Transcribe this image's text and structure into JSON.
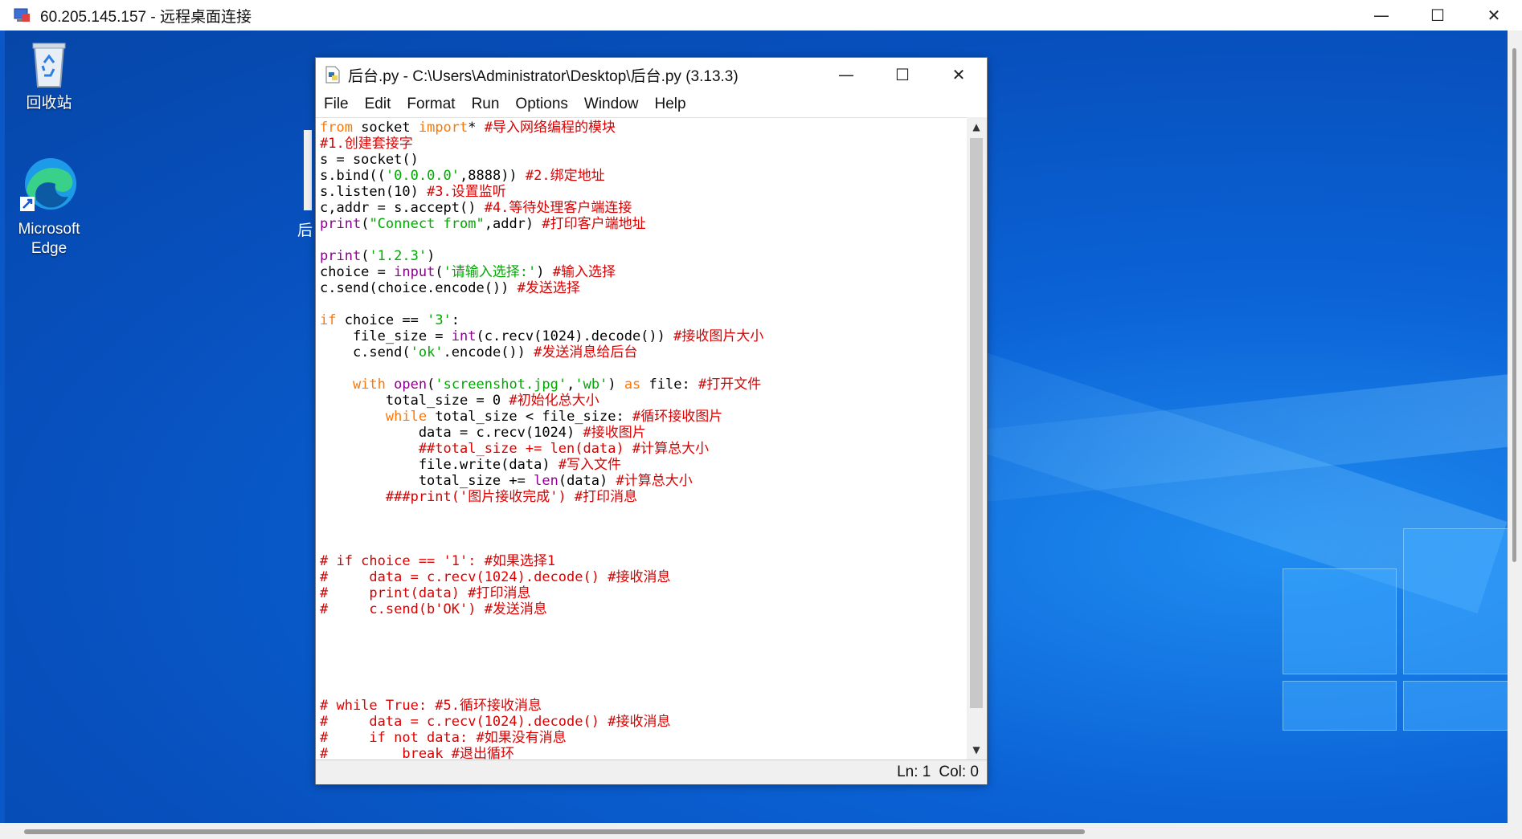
{
  "rdp": {
    "title": "60.205.145.157 - 远程桌面连接",
    "minimize": "—",
    "maximize": "☐",
    "close": "✕"
  },
  "desktop": {
    "icons": [
      {
        "label": "回收站",
        "icon": "recycle-bin-icon"
      },
      {
        "label": "Microsoft Edge",
        "icon": "edge-icon"
      }
    ],
    "partial_label": "后"
  },
  "idle": {
    "title": "后台.py - C:\\Users\\Administrator\\Desktop\\后台.py (3.13.3)",
    "minimize": "—",
    "maximize": "☐",
    "close": "✕",
    "menu": [
      "File",
      "Edit",
      "Format",
      "Run",
      "Options",
      "Window",
      "Help"
    ],
    "status": {
      "line": "Ln: 1",
      "col": "Col: 0"
    }
  },
  "code_lines": [
    [
      {
        "t": "from",
        "c": "kw"
      },
      {
        "t": " socket "
      },
      {
        "t": "import",
        "c": "kw"
      },
      {
        "t": "* "
      },
      {
        "t": "#导入网络编程的模块",
        "c": "cm"
      }
    ],
    [
      {
        "t": "#1.创建套接字",
        "c": "cm"
      }
    ],
    [
      {
        "t": "s = socket()"
      }
    ],
    [
      {
        "t": "s.bind(("
      },
      {
        "t": "'0.0.0.0'",
        "c": "str"
      },
      {
        "t": ",8888)) "
      },
      {
        "t": "#2.绑定地址",
        "c": "cm"
      }
    ],
    [
      {
        "t": "s.listen(10) "
      },
      {
        "t": "#3.设置监听",
        "c": "cm"
      }
    ],
    [
      {
        "t": "c,addr = s.accept() "
      },
      {
        "t": "#4.等待处理客户端连接",
        "c": "cm"
      }
    ],
    [
      {
        "t": "print",
        "c": "bi"
      },
      {
        "t": "("
      },
      {
        "t": "\"Connect from\"",
        "c": "str"
      },
      {
        "t": ",addr) "
      },
      {
        "t": "#打印客户端地址",
        "c": "cm"
      }
    ],
    [
      {
        "t": ""
      }
    ],
    [
      {
        "t": "print",
        "c": "bi"
      },
      {
        "t": "("
      },
      {
        "t": "'1.2.3'",
        "c": "str"
      },
      {
        "t": ")"
      }
    ],
    [
      {
        "t": "choice = "
      },
      {
        "t": "input",
        "c": "bi"
      },
      {
        "t": "("
      },
      {
        "t": "'请输入选择:'",
        "c": "str"
      },
      {
        "t": ") "
      },
      {
        "t": "#输入选择",
        "c": "cm"
      }
    ],
    [
      {
        "t": "c.send(choice.encode()) "
      },
      {
        "t": "#发送选择",
        "c": "cm"
      }
    ],
    [
      {
        "t": ""
      }
    ],
    [
      {
        "t": "if",
        "c": "kw"
      },
      {
        "t": " choice == "
      },
      {
        "t": "'3'",
        "c": "str"
      },
      {
        "t": ":"
      }
    ],
    [
      {
        "t": "    file_size = "
      },
      {
        "t": "int",
        "c": "bi"
      },
      {
        "t": "(c.recv(1024).decode()) "
      },
      {
        "t": "#接收图片大小",
        "c": "cm"
      }
    ],
    [
      {
        "t": "    c.send("
      },
      {
        "t": "'ok'",
        "c": "str"
      },
      {
        "t": ".encode()) "
      },
      {
        "t": "#发送消息给后台",
        "c": "cm"
      }
    ],
    [
      {
        "t": ""
      }
    ],
    [
      {
        "t": "    "
      },
      {
        "t": "with",
        "c": "kw"
      },
      {
        "t": " "
      },
      {
        "t": "open",
        "c": "bi"
      },
      {
        "t": "("
      },
      {
        "t": "'screenshot.jpg'",
        "c": "str"
      },
      {
        "t": ","
      },
      {
        "t": "'wb'",
        "c": "str"
      },
      {
        "t": ") "
      },
      {
        "t": "as",
        "c": "kw"
      },
      {
        "t": " file: "
      },
      {
        "t": "#打开文件",
        "c": "cm"
      }
    ],
    [
      {
        "t": "        total_size = 0 "
      },
      {
        "t": "#初始化总大小",
        "c": "cm"
      }
    ],
    [
      {
        "t": "        "
      },
      {
        "t": "while",
        "c": "kw"
      },
      {
        "t": " total_size < file_size: "
      },
      {
        "t": "#循环接收图片",
        "c": "cm"
      }
    ],
    [
      {
        "t": "            data = c.recv(1024) "
      },
      {
        "t": "#接收图片",
        "c": "cm"
      }
    ],
    [
      {
        "t": "            ##total_size += len(data) #计算总大小",
        "c": "cm"
      }
    ],
    [
      {
        "t": "            file.write(data) "
      },
      {
        "t": "#写入文件",
        "c": "cm"
      }
    ],
    [
      {
        "t": "            total_size += "
      },
      {
        "t": "len",
        "c": "bi"
      },
      {
        "t": "(data) "
      },
      {
        "t": "#计算总大小",
        "c": "cm"
      }
    ],
    [
      {
        "t": "        ###print('图片接收完成') #打印消息",
        "c": "cm"
      }
    ],
    [
      {
        "t": ""
      }
    ],
    [
      {
        "t": ""
      }
    ],
    [
      {
        "t": ""
      }
    ],
    [
      {
        "t": "# if choice == '1': #如果选择1",
        "c": "cm"
      }
    ],
    [
      {
        "t": "#     data = c.recv(1024).decode() #接收消息",
        "c": "cm"
      }
    ],
    [
      {
        "t": "#     print(data) #打印消息",
        "c": "cm"
      }
    ],
    [
      {
        "t": "#     c.send(b'OK') #发送消息",
        "c": "cm"
      }
    ],
    [
      {
        "t": ""
      }
    ],
    [
      {
        "t": ""
      }
    ],
    [
      {
        "t": ""
      }
    ],
    [
      {
        "t": ""
      }
    ],
    [
      {
        "t": ""
      }
    ],
    [
      {
        "t": "# while True: #5.循环接收消息",
        "c": "cm"
      }
    ],
    [
      {
        "t": "#     data = c.recv(1024).decode() #接收消息",
        "c": "cm"
      }
    ],
    [
      {
        "t": "#     if not data: #如果没有消息",
        "c": "cm"
      }
    ],
    [
      {
        "t": "#         break #退出循环",
        "c": "cm"
      }
    ]
  ]
}
